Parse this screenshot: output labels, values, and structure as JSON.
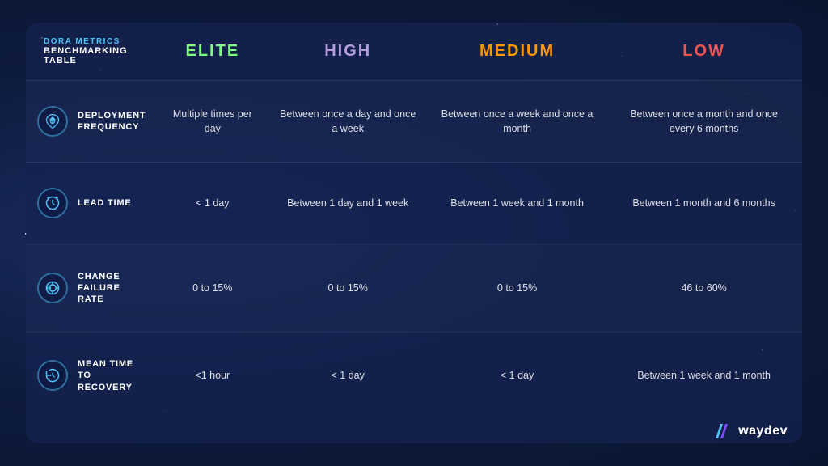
{
  "header": {
    "label_top": "DORA METRICS",
    "label_bottom": "BENCHMARKING TABLE",
    "elite": "ELITE",
    "high": "HIGH",
    "medium": "MEDIUM",
    "low": "LOW"
  },
  "rows": [
    {
      "id": "deployment-frequency",
      "icon": "deployment",
      "metric": [
        "DEPLOYMENT",
        "FREQUENCY"
      ],
      "elite": "Multiple times per day",
      "high": "Between once a day and once a week",
      "medium": "Between once a week and once a month",
      "low": "Between once a month and once every 6 months"
    },
    {
      "id": "lead-time",
      "icon": "clock",
      "metric": [
        "LEAD TIME"
      ],
      "elite": "< 1 day",
      "high": "Between 1 day and 1 week",
      "medium": "Between 1 week and 1 month",
      "low": "Between 1 month and 6 months"
    },
    {
      "id": "change-failure-rate",
      "icon": "target",
      "metric": [
        "CHANGE",
        "FAILURE RATE"
      ],
      "elite": "0 to 15%",
      "high": "0 to 15%",
      "medium": "0 to 15%",
      "low": "46 to 60%"
    },
    {
      "id": "mean-time-recovery",
      "icon": "recovery",
      "metric": [
        "MEAN TIME TO",
        "RECOVERY"
      ],
      "elite": "<1 hour",
      "high": "< 1 day",
      "medium": "< 1 day",
      "low": "Between 1 week and 1 month"
    }
  ],
  "logo": {
    "text": "waydev"
  },
  "colors": {
    "elite": "#7fff7f",
    "high": "#b39ddb",
    "medium": "#ff9800",
    "low": "#ef5350",
    "icon_stroke": "#4fc3f7"
  }
}
